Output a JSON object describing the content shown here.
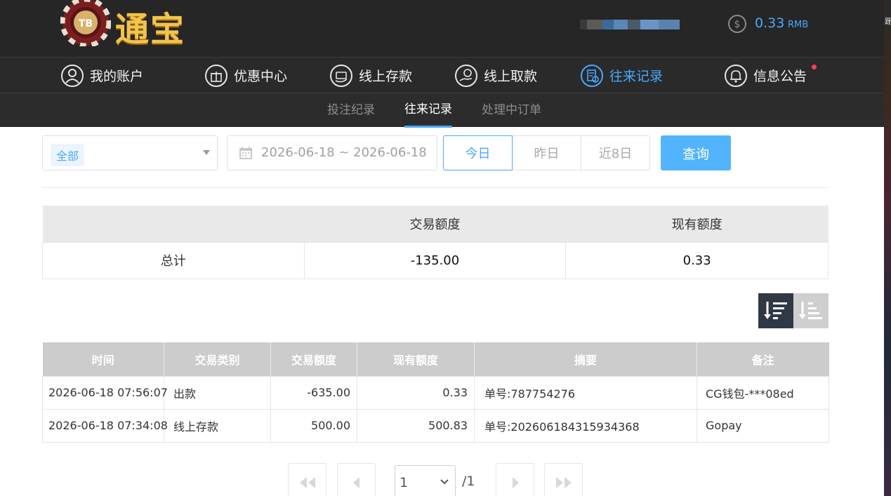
{
  "header": {
    "logo_badge": "TB",
    "logo_text": "通宝",
    "balance_amount": "0.33",
    "balance_unit": "RMB"
  },
  "main_nav": [
    {
      "label": "我的账户",
      "icon": "user-icon"
    },
    {
      "label": "优惠中心",
      "icon": "gift-icon"
    },
    {
      "label": "线上存款",
      "icon": "deposit-icon"
    },
    {
      "label": "线上取款",
      "icon": "withdraw-icon"
    },
    {
      "label": "往来记录",
      "icon": "records-icon",
      "active": true
    },
    {
      "label": "信息公告",
      "icon": "bell-icon"
    }
  ],
  "sub_nav": [
    {
      "label": "投注纪录"
    },
    {
      "label": "往来记录",
      "active": true
    },
    {
      "label": "处理中订单"
    }
  ],
  "filters": {
    "type_selected": "全部",
    "date_range": "2026-06-18 ~ 2026-06-18",
    "quick": [
      "今日",
      "昨日",
      "近8日"
    ],
    "query_label": "查询"
  },
  "summary": {
    "headers": [
      "",
      "交易额度",
      "现有额度"
    ],
    "row_label": "总计",
    "transaction_total": "-135.00",
    "current_balance": "0.33"
  },
  "records": {
    "headers": [
      "时间",
      "交易类别",
      "交易额度",
      "现有额度",
      "摘要",
      "备注"
    ],
    "rows": [
      {
        "time": "2026-06-18 07:56:07",
        "type": "出款",
        "amount": "-635.00",
        "balance": "0.33",
        "summary": "单号:787754276",
        "remark": "CG钱包-***08ed"
      },
      {
        "time": "2026-06-18 07:34:08",
        "type": "线上存款",
        "amount": "500.00",
        "balance": "500.83",
        "summary": "单号:202606184315934368",
        "remark": "Gopay"
      }
    ]
  },
  "pagination": {
    "current_page": "1",
    "total_pages": "/1"
  },
  "colors": {
    "accent": "#49a8ff",
    "header_bg": "#262626",
    "logo_gold": "#f2c44a",
    "notify_dot": "#ff3d5a"
  }
}
